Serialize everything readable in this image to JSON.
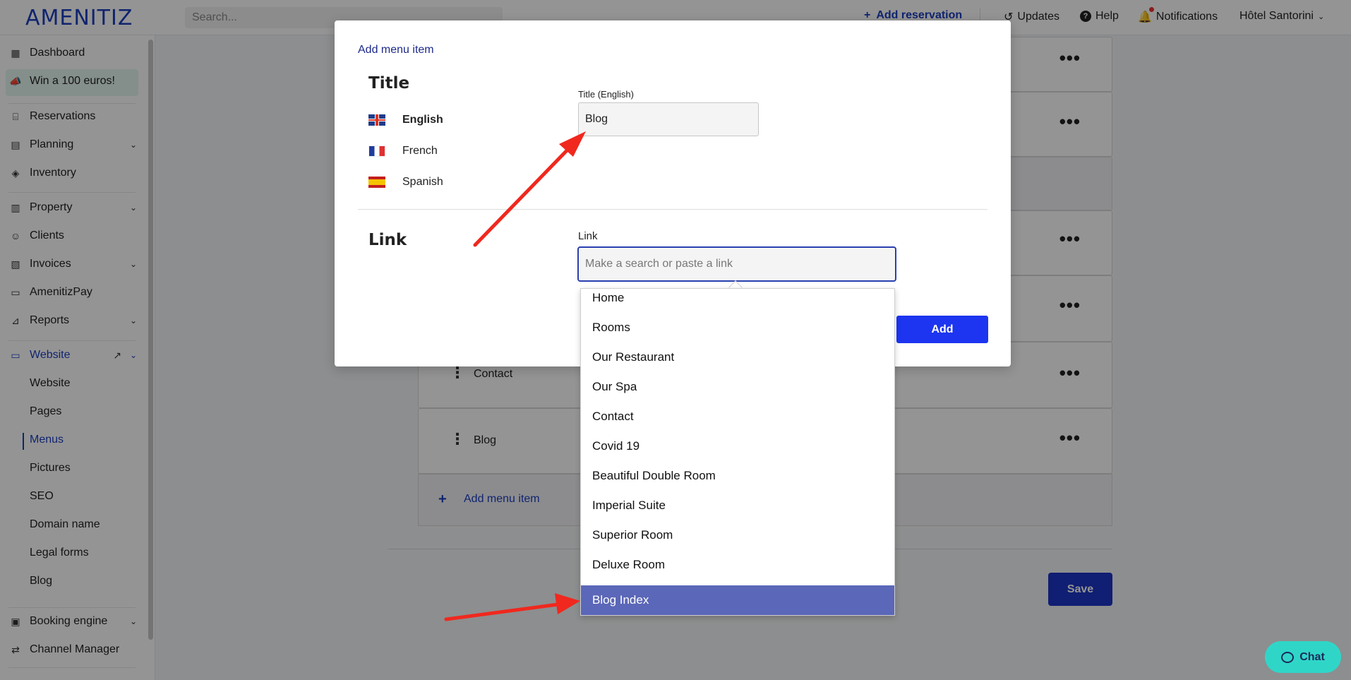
{
  "app": {
    "logo": "AMENITIZ",
    "search_placeholder": "Search...",
    "add_reservation": "Add reservation",
    "updates": "Updates",
    "help": "Help",
    "notifications": "Notifications",
    "hotel": "Hôtel Santorini",
    "accent_color": "#1d3ec0"
  },
  "sidebar": {
    "dashboard": "Dashboard",
    "promo": "Win a 100 euros!",
    "reservations": "Reservations",
    "planning": "Planning",
    "inventory": "Inventory",
    "property": "Property",
    "clients": "Clients",
    "invoices": "Invoices",
    "amenitizpay": "AmenitizPay",
    "reports": "Reports",
    "website": "Website",
    "website_sub": [
      "Website",
      "Pages",
      "Menus",
      "Pictures",
      "SEO",
      "Domain name",
      "Legal forms",
      "Blog"
    ],
    "booking_engine": "Booking engine",
    "channel_manager": "Channel Manager"
  },
  "menu_rows": {
    "contact": "Contact",
    "blog": "Blog",
    "add_menu_item": "Add menu item",
    "save": "Save"
  },
  "modal": {
    "heading": "Add menu item",
    "title_section": "Title",
    "languages": [
      "English",
      "French",
      "Spanish"
    ],
    "title_field_label": "Title (English)",
    "title_value": "Blog",
    "link_section": "Link",
    "link_field_label": "Link",
    "link_placeholder": "Make a search or paste a link",
    "add_button": "Add"
  },
  "dropdown": {
    "options": [
      "Home",
      "Rooms",
      "Our Restaurant",
      "Our Spa",
      "Contact",
      "Covid 19",
      "Beautiful Double Room",
      "Imperial Suite",
      "Superior Room",
      "Deluxe Room",
      "Blog Index"
    ],
    "selected": "Blog Index",
    "selected_color": "#5b67b8"
  },
  "chat": {
    "label": "Chat"
  }
}
